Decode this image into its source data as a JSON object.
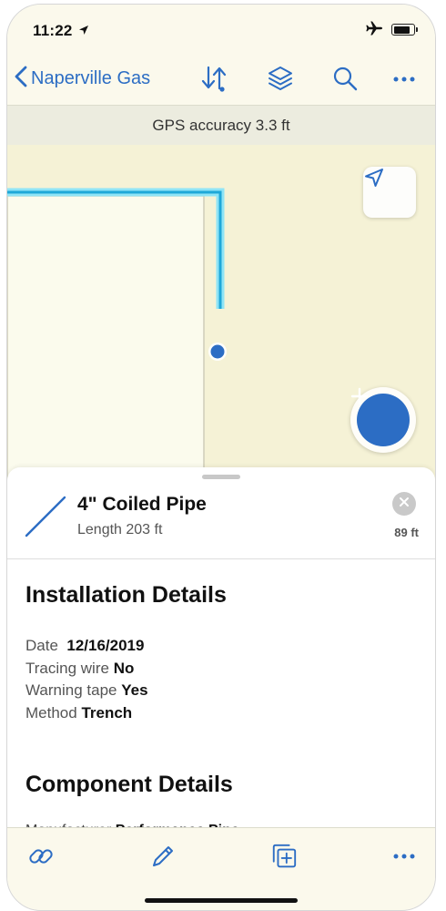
{
  "status_bar": {
    "time": "11:22"
  },
  "nav": {
    "back_label": "Naperville Gas"
  },
  "gps": {
    "accuracy_text": "GPS accuracy 3.3 ft"
  },
  "colors": {
    "accent": "#2c6dc4",
    "pipe": "#1fa8d8",
    "pipe_glow": "#8fe4f6",
    "map_background": "#f5f2d6"
  },
  "feature": {
    "title": "4\" Coiled Pipe",
    "subtitle": "Length 203 ft",
    "distance": "89 ft"
  },
  "sections": {
    "installation": {
      "title": "Installation Details",
      "rows": [
        {
          "label": "Date",
          "value": "12/16/2019"
        },
        {
          "label": "Tracing wire",
          "value": "No"
        },
        {
          "label": "Warning tape",
          "value": "Yes"
        },
        {
          "label": "Method",
          "value": "Trench"
        }
      ]
    },
    "component": {
      "title": "Component Details",
      "partial_label": "Manufacturer",
      "partial_value": "Performance Pipe"
    }
  },
  "icons": {
    "nav": [
      "back-chevron-icon",
      "sort-icon",
      "layers-icon",
      "search-icon",
      "more-icon"
    ],
    "toolbar": [
      "link-icon",
      "pencil-icon",
      "duplicate-icon",
      "more-icon"
    ],
    "map": [
      "navigation-arrow-icon",
      "plus-icon"
    ]
  }
}
